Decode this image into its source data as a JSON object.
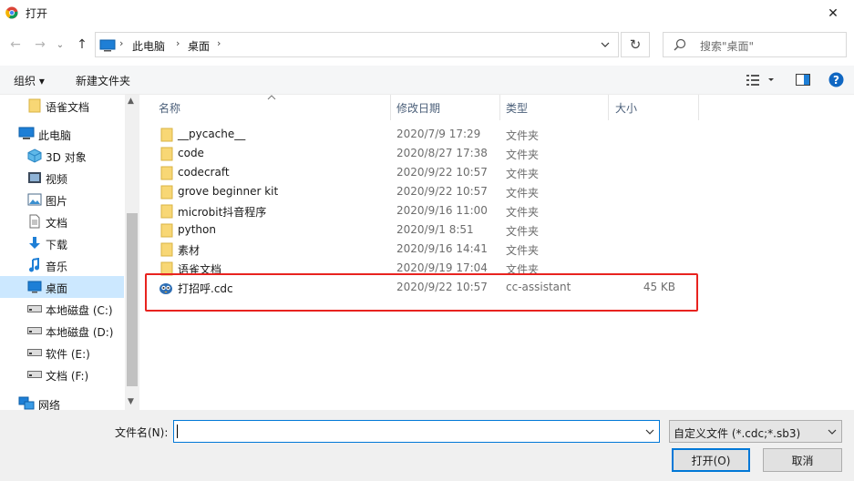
{
  "window": {
    "title": "打开",
    "close_glyph": "✕"
  },
  "nav": {
    "back_glyph": "←",
    "forward_glyph": "→",
    "recent_glyph": "⌄",
    "up_glyph": "↑",
    "breadcrumb": [
      "此电脑",
      "桌面"
    ],
    "breadcrumb_sep": "›",
    "refresh_glyph": "↻",
    "search_placeholder": "搜索\"桌面\""
  },
  "toolbar": {
    "organize_label": "组织 ▾",
    "new_folder_label": "新建文件夹"
  },
  "sidebar": {
    "items": [
      {
        "label": "语雀文档",
        "icon": "folder-icon"
      },
      {
        "label": "此电脑",
        "icon": "computer-icon"
      },
      {
        "label": "3D 对象",
        "icon": "3d-objects-icon"
      },
      {
        "label": "视频",
        "icon": "video-icon"
      },
      {
        "label": "图片",
        "icon": "picture-icon"
      },
      {
        "label": "文档",
        "icon": "document-icon"
      },
      {
        "label": "下载",
        "icon": "download-icon"
      },
      {
        "label": "音乐",
        "icon": "music-icon"
      },
      {
        "label": "桌面",
        "icon": "desktop-icon",
        "selected": true
      },
      {
        "label": "本地磁盘 (C:)",
        "icon": "drive-icon"
      },
      {
        "label": "本地磁盘 (D:)",
        "icon": "drive-icon"
      },
      {
        "label": "软件 (E:)",
        "icon": "drive-icon"
      },
      {
        "label": "文档 (F:)",
        "icon": "drive-icon"
      },
      {
        "label": "网络",
        "icon": "network-icon"
      }
    ]
  },
  "columns": {
    "name": "名称",
    "date": "修改日期",
    "type": "类型",
    "size": "大小"
  },
  "files": [
    {
      "name": "__pycache__",
      "date": "2020/7/9 17:29",
      "type": "文件夹",
      "size": "",
      "icon": "folder-icon"
    },
    {
      "name": "code",
      "date": "2020/8/27 17:38",
      "type": "文件夹",
      "size": "",
      "icon": "folder-icon"
    },
    {
      "name": "codecraft",
      "date": "2020/9/22 10:57",
      "type": "文件夹",
      "size": "",
      "icon": "folder-icon"
    },
    {
      "name": "grove beginner kit",
      "date": "2020/9/22 10:57",
      "type": "文件夹",
      "size": "",
      "icon": "folder-icon"
    },
    {
      "name": "microbit抖音程序",
      "date": "2020/9/16 11:00",
      "type": "文件夹",
      "size": "",
      "icon": "folder-icon"
    },
    {
      "name": "python",
      "date": "2020/9/1 8:51",
      "type": "文件夹",
      "size": "",
      "icon": "folder-icon"
    },
    {
      "name": "素材",
      "date": "2020/9/16 14:41",
      "type": "文件夹",
      "size": "",
      "icon": "folder-icon"
    },
    {
      "name": "语雀文档",
      "date": "2020/9/19 17:04",
      "type": "文件夹",
      "size": "",
      "icon": "folder-icon"
    },
    {
      "name": "打招呼.cdc",
      "date": "2020/9/22 10:57",
      "type": "cc-assistant",
      "size": "45 KB",
      "icon": "cdc-file-icon"
    }
  ],
  "footer": {
    "filename_label": "文件名(N):",
    "filename_value": "",
    "filetype_value": "自定义文件 (*.cdc;*.sb3)",
    "open_label": "打开(O)",
    "cancel_label": "取消"
  },
  "colors": {
    "accent": "#0078d7",
    "selection": "#cce8ff",
    "folder": "#f8d775",
    "highlight_box": "#e8231f"
  }
}
